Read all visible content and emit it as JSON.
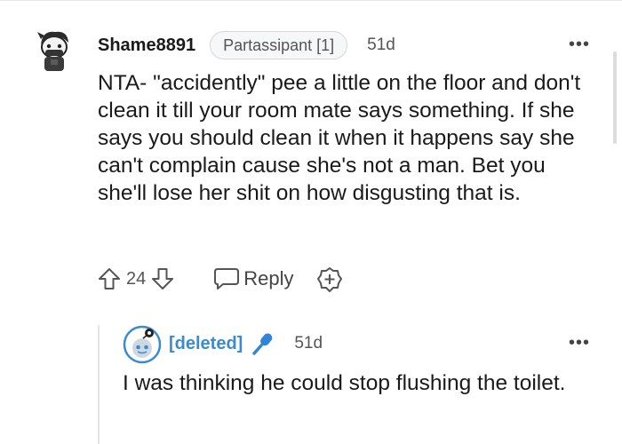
{
  "comment": {
    "username": "Shame8891",
    "flair": "Partassipant [1]",
    "age": "51d",
    "more_label": "•••",
    "body": "NTA- \"accidently\" pee a little on the floor and don't clean it till your room mate says something. If she says you should clean it when it happens say she can't complain cause she's not a man. Bet you she'll lose her shit on how disgusting that is.",
    "score": "24",
    "reply_label": "Reply",
    "avatar_icon": "snoo-avatar-icon",
    "upvote_icon": "upvote-arrow-icon",
    "downvote_icon": "downvote-arrow-icon",
    "reply_icon": "speech-bubble-icon",
    "award_icon": "award-plus-icon"
  },
  "reply": {
    "username": "[deleted]",
    "age": "51d",
    "more_label": "•••",
    "body": "I was thinking he could stop flushing the toilet.",
    "avatar_icon": "deleted-user-avatar-icon",
    "badge_icon": "microphone-icon"
  },
  "colors": {
    "deleted_user": "#3a8bd0",
    "mic_badge": "#2f86d6",
    "text": "#1a1a1b",
    "meta": "#555555"
  }
}
